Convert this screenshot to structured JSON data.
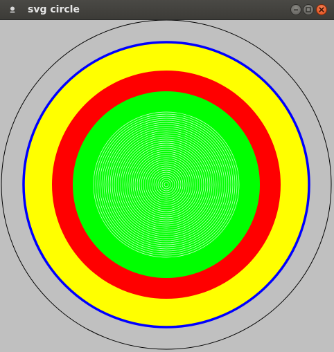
{
  "window": {
    "title": "svg circle",
    "controls": {
      "minimize": "minimize-icon",
      "maximize": "maximize-icon",
      "close": "close-icon"
    },
    "app_icon": "app-icon"
  },
  "canvas": {
    "background_color": "#c0c0c0",
    "circles": [
      {
        "name": "outer-thin-circle",
        "fill": "none",
        "stroke": "#000000"
      },
      {
        "name": "yellow-circle",
        "fill": "#ffff00",
        "stroke": "#0000ff"
      },
      {
        "name": "red-circle",
        "fill": "#ff0000",
        "stroke": "none"
      },
      {
        "name": "green-circle",
        "fill": "#00ff00",
        "stroke": "none"
      }
    ],
    "concentric_rings_color": "#ffffff"
  }
}
